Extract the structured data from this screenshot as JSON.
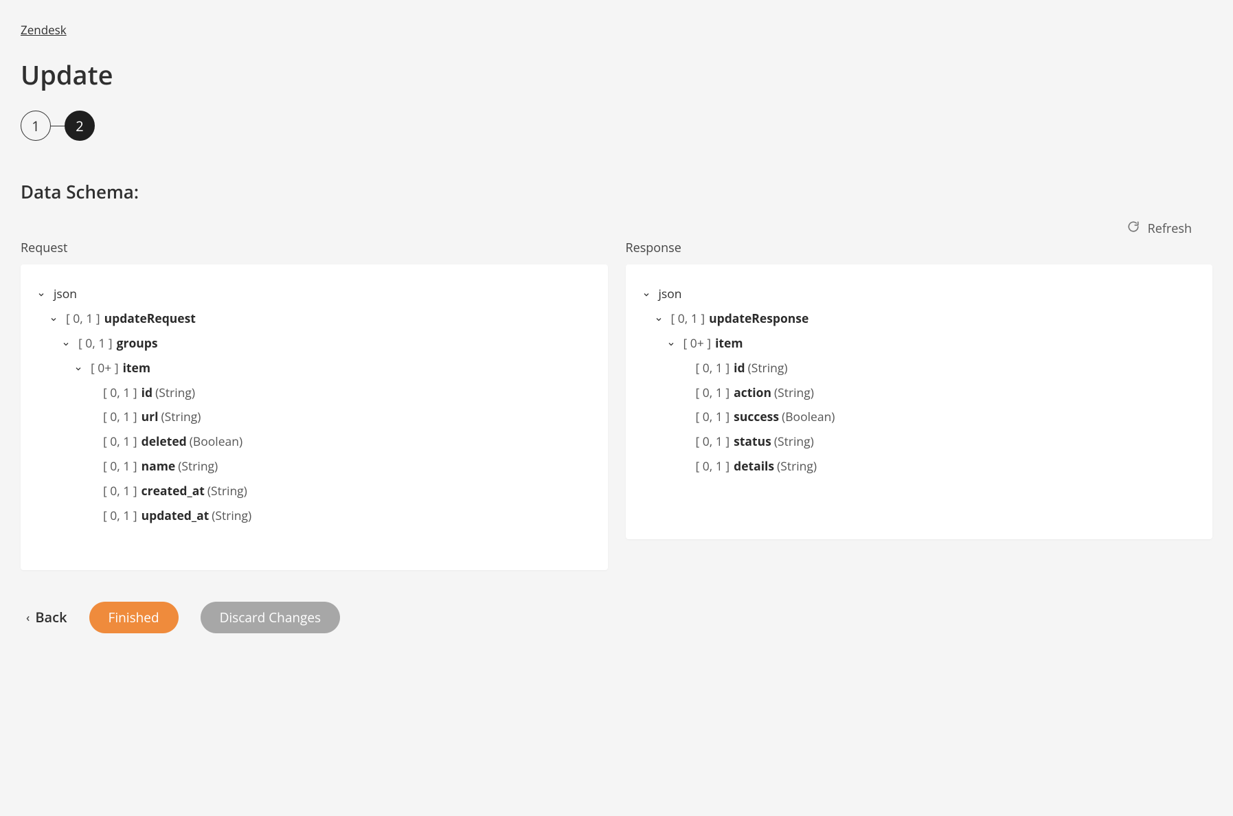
{
  "breadcrumb": {
    "label": "Zendesk"
  },
  "page": {
    "title": "Update"
  },
  "stepper": {
    "steps": [
      "1",
      "2"
    ],
    "activeIndex": 1
  },
  "section": {
    "title": "Data Schema:"
  },
  "refresh": {
    "label": "Refresh"
  },
  "columns": {
    "request": {
      "label": "Request"
    },
    "response": {
      "label": "Response"
    }
  },
  "requestTree": {
    "root": "json",
    "updateRequest": {
      "card": "[ 0, 1 ]",
      "name": "updateRequest"
    },
    "groups": {
      "card": "[ 0, 1 ]",
      "name": "groups"
    },
    "item": {
      "card": "[ 0+ ]",
      "name": "item"
    },
    "fields": {
      "id": {
        "card": "[ 0, 1 ]",
        "name": "id",
        "type": "(String)"
      },
      "url": {
        "card": "[ 0, 1 ]",
        "name": "url",
        "type": "(String)"
      },
      "deleted": {
        "card": "[ 0, 1 ]",
        "name": "deleted",
        "type": "(Boolean)"
      },
      "name": {
        "card": "[ 0, 1 ]",
        "name": "name",
        "type": "(String)"
      },
      "createdAt": {
        "card": "[ 0, 1 ]",
        "name": "created_at",
        "type": "(String)"
      },
      "updatedAt": {
        "card": "[ 0, 1 ]",
        "name": "updated_at",
        "type": "(String)"
      }
    }
  },
  "responseTree": {
    "root": "json",
    "updateResponse": {
      "card": "[ 0, 1 ]",
      "name": "updateResponse"
    },
    "item": {
      "card": "[ 0+ ]",
      "name": "item"
    },
    "fields": {
      "id": {
        "card": "[ 0, 1 ]",
        "name": "id",
        "type": "(String)"
      },
      "action": {
        "card": "[ 0, 1 ]",
        "name": "action",
        "type": "(String)"
      },
      "success": {
        "card": "[ 0, 1 ]",
        "name": "success",
        "type": "(Boolean)"
      },
      "status": {
        "card": "[ 0, 1 ]",
        "name": "status",
        "type": "(String)"
      },
      "details": {
        "card": "[ 0, 1 ]",
        "name": "details",
        "type": "(String)"
      }
    }
  },
  "footer": {
    "back": "Back",
    "finished": "Finished",
    "discard": "Discard Changes"
  }
}
